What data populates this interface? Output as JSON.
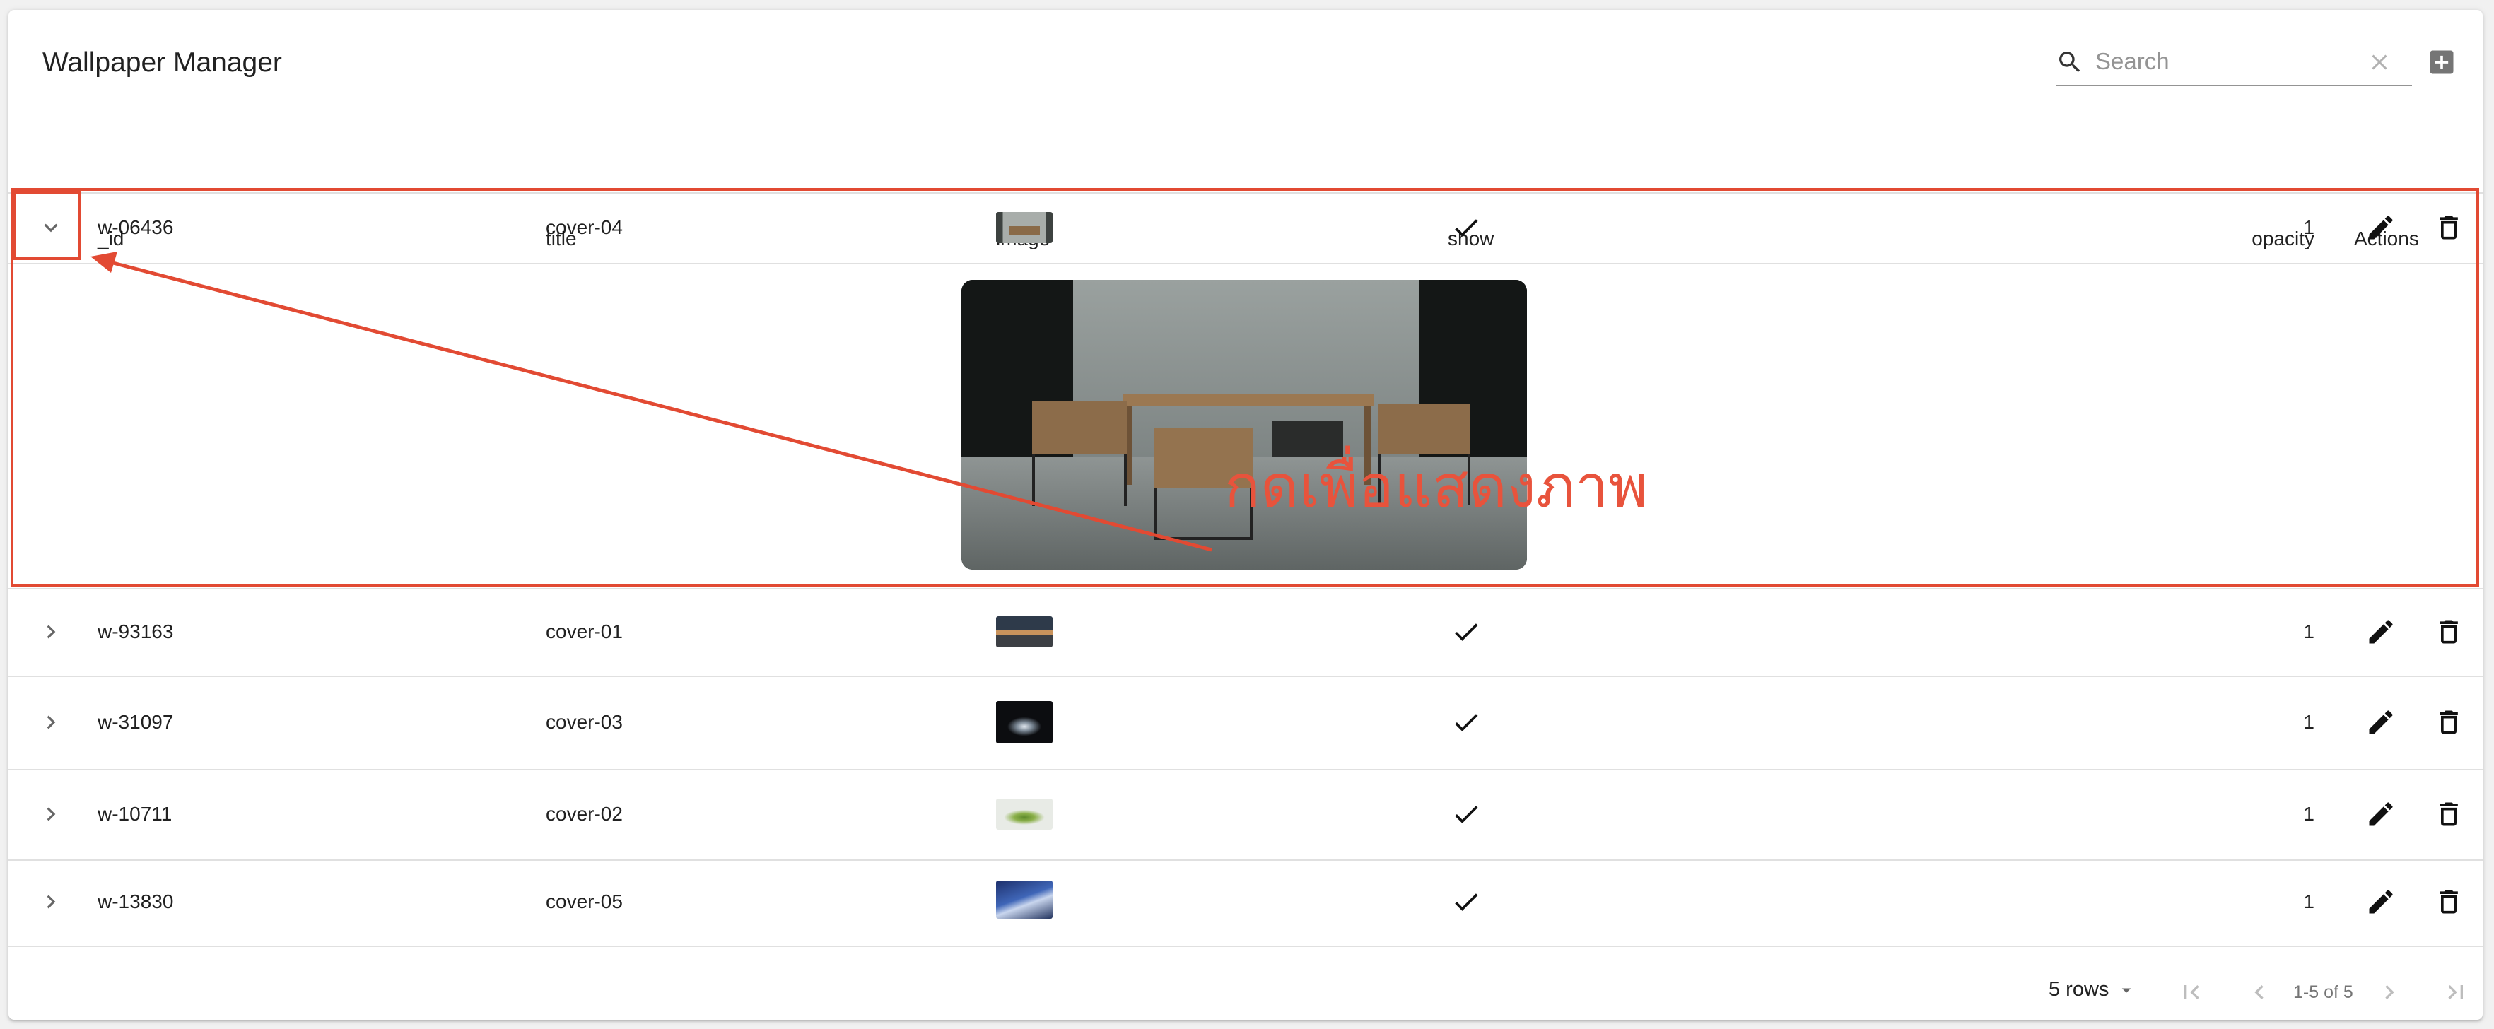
{
  "app": {
    "title": "Wallpaper Manager"
  },
  "search": {
    "placeholder": "Search",
    "value": ""
  },
  "table": {
    "columns": {
      "id": "_id",
      "title": "title",
      "image": "image",
      "show": "show",
      "opacity": "opacity",
      "actions": "Actions"
    },
    "rows": [
      {
        "id": "w-06436",
        "title": "cover-04",
        "show": true,
        "opacity": "1",
        "expanded": true
      },
      {
        "id": "w-93163",
        "title": "cover-01",
        "show": true,
        "opacity": "1",
        "expanded": false
      },
      {
        "id": "w-31097",
        "title": "cover-03",
        "show": true,
        "opacity": "1",
        "expanded": false
      },
      {
        "id": "w-10711",
        "title": "cover-02",
        "show": true,
        "opacity": "1",
        "expanded": false
      },
      {
        "id": "w-13830",
        "title": "cover-05",
        "show": true,
        "opacity": "1",
        "expanded": false
      }
    ]
  },
  "pagination": {
    "rows_label": "5 rows",
    "range": "1-5 of 5"
  },
  "annotation": {
    "text": "กดเพื่อแสดงภาพ",
    "color": "#e24a33"
  },
  "icons": {
    "search": "search-icon",
    "clear": "close-icon",
    "add": "add-box-icon",
    "expand": "chevron-icon",
    "show": "check-icon",
    "edit": "pencil-icon",
    "delete": "trash-icon",
    "first": "first-page-icon",
    "prev": "chevron-left-icon",
    "next": "chevron-right-icon",
    "last": "last-page-icon"
  }
}
